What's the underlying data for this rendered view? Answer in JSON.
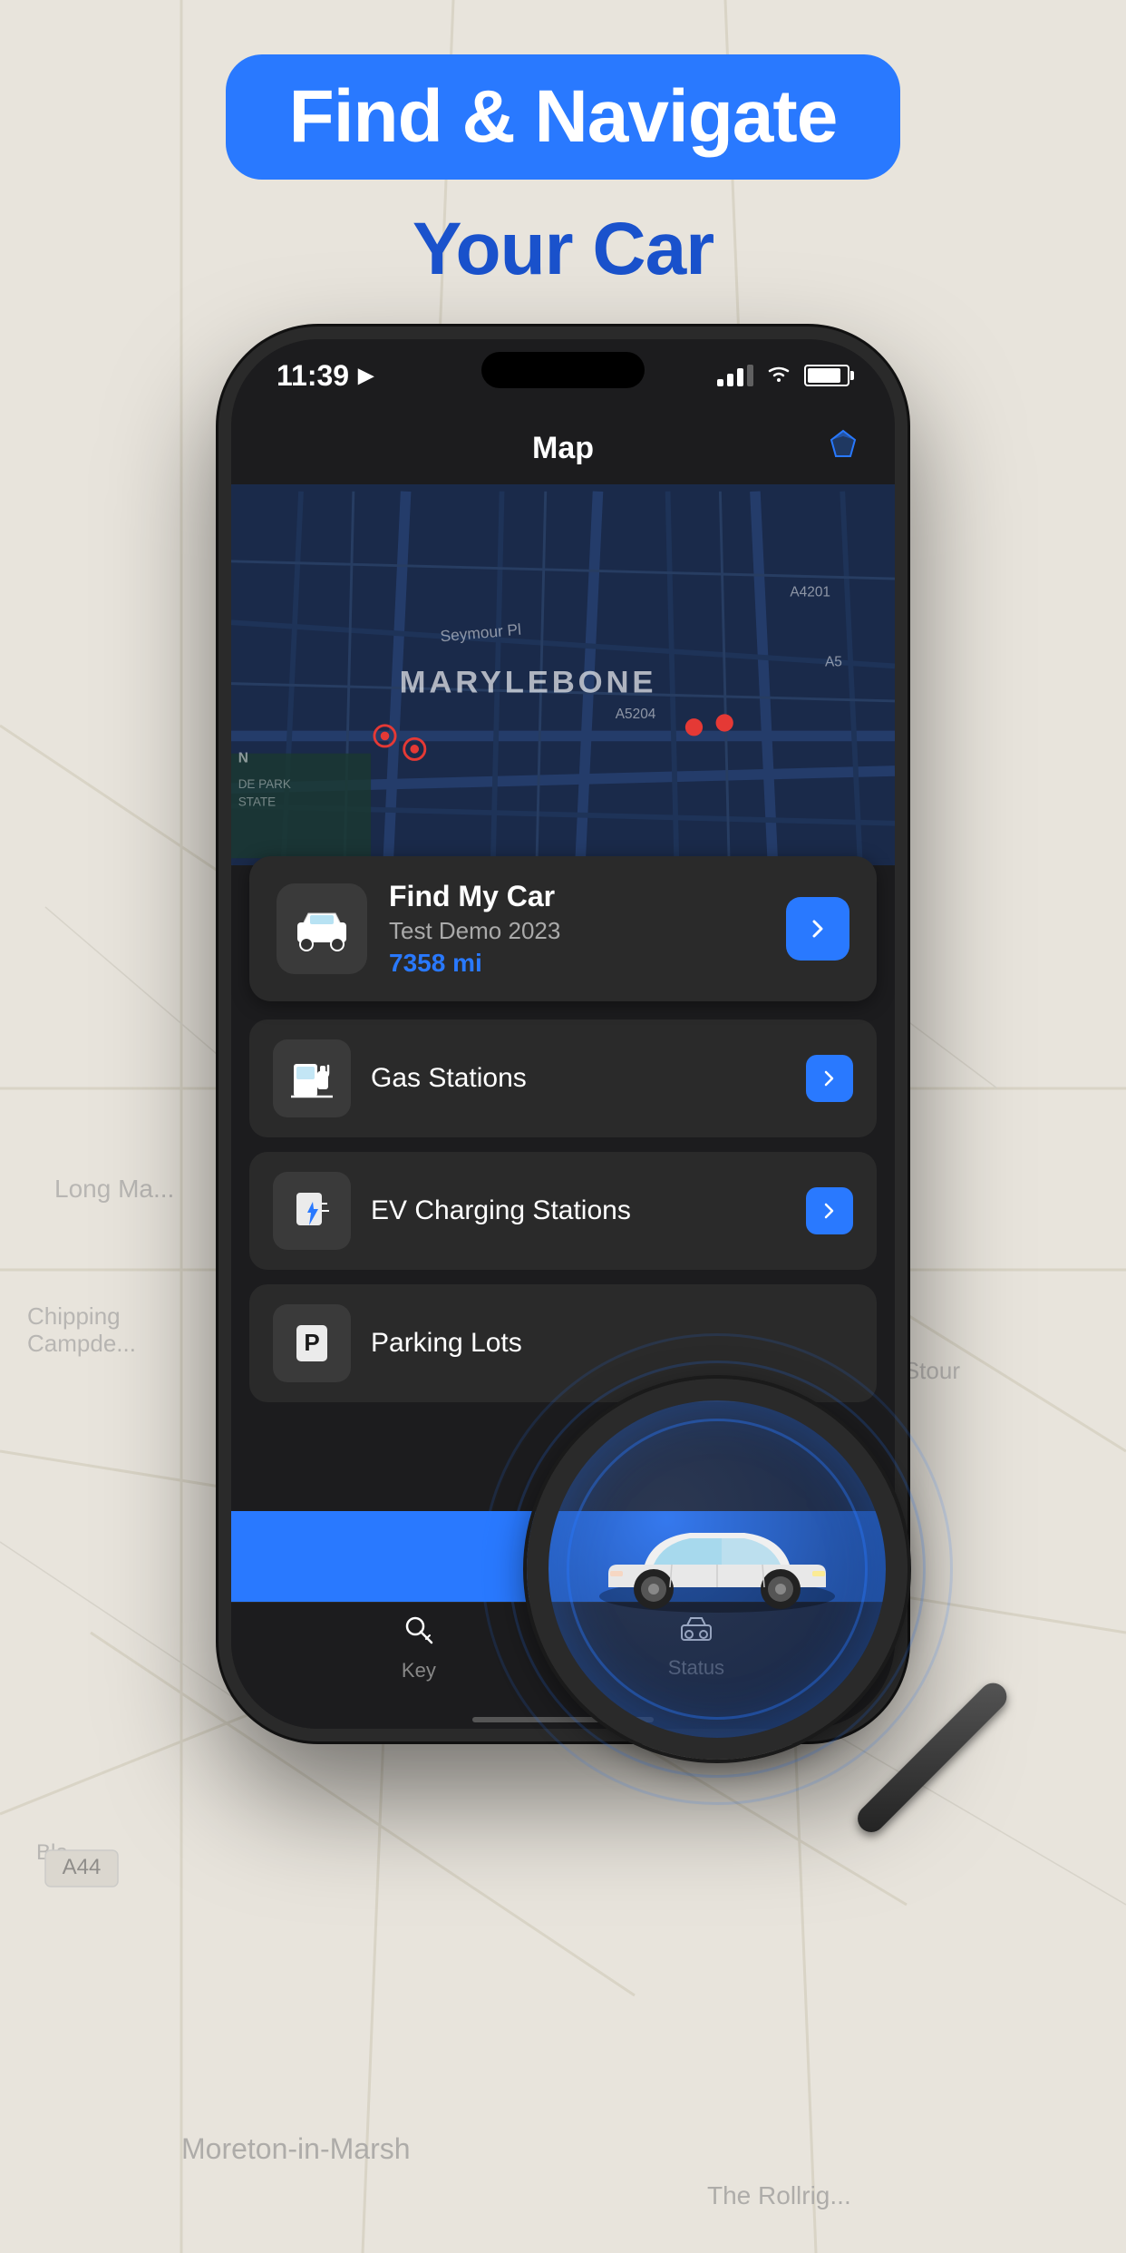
{
  "header": {
    "headline_line1": "Find & Navigate",
    "headline_line2": "Your Car",
    "badge_bg": "#2979ff",
    "text_color": "#1a52cc"
  },
  "phone": {
    "status_bar": {
      "time": "11:39",
      "signal": "●●●",
      "wifi": "wifi",
      "battery": "battery"
    },
    "nav_bar": {
      "title": "Map",
      "gem_label": "◆"
    },
    "map": {
      "district_label": "MARYLEBONE"
    },
    "find_my_car": {
      "title": "Find My Car",
      "subtitle": "Test Demo 2023",
      "mileage": "7358 mi",
      "arrow_label": "›"
    },
    "services": [
      {
        "id": "gas-stations",
        "label": "Gas Stations",
        "icon": "⛽"
      },
      {
        "id": "ev-charging",
        "label": "EV Charging Stations",
        "icon": "⚡"
      },
      {
        "id": "parking",
        "label": "Parking Lots",
        "icon": "P"
      }
    ],
    "tab_bar": {
      "tabs": [
        {
          "id": "key",
          "label": "Key",
          "icon": "🔑"
        },
        {
          "id": "status",
          "label": "Status",
          "icon": "🚗"
        }
      ]
    }
  },
  "magnifier": {
    "label": "magnifier with car"
  }
}
